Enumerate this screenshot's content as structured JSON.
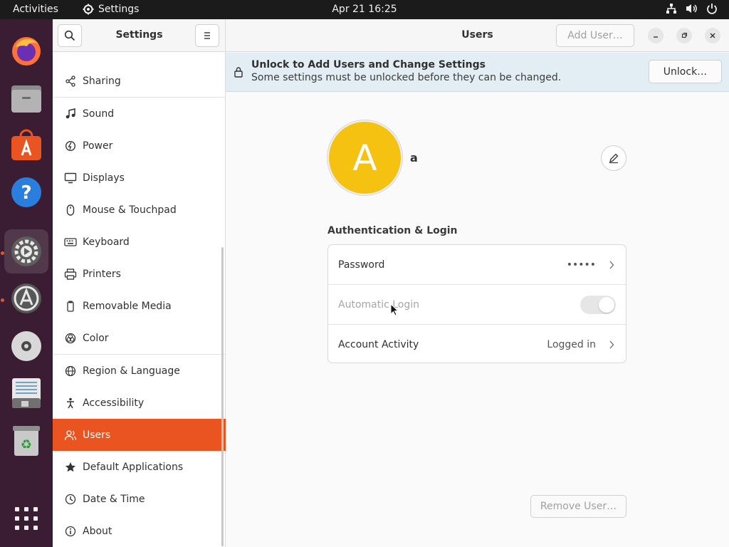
{
  "topbar": {
    "activities": "Activities",
    "app_name": "Settings",
    "clock": "Apr 21  16:25"
  },
  "dock": {
    "items": [
      "firefox-icon",
      "files-icon",
      "software-store-icon",
      "help-icon",
      "settings-icon",
      "software-updater-icon",
      "disc-icon",
      "text-editor-icon",
      "trash-icon",
      "app-grid-icon"
    ]
  },
  "sidebar": {
    "title": "Settings",
    "items": [
      {
        "label": "Sharing",
        "icon": "share-icon"
      },
      {
        "label": "Sound",
        "icon": "music-note-icon"
      },
      {
        "label": "Power",
        "icon": "power-icon"
      },
      {
        "label": "Displays",
        "icon": "display-icon"
      },
      {
        "label": "Mouse & Touchpad",
        "icon": "mouse-icon"
      },
      {
        "label": "Keyboard",
        "icon": "keyboard-icon"
      },
      {
        "label": "Printers",
        "icon": "printer-icon"
      },
      {
        "label": "Removable Media",
        "icon": "removable-media-icon"
      },
      {
        "label": "Color",
        "icon": "color-icon"
      },
      {
        "label": "Region & Language",
        "icon": "globe-icon"
      },
      {
        "label": "Accessibility",
        "icon": "accessibility-icon"
      },
      {
        "label": "Users",
        "icon": "users-icon"
      },
      {
        "label": "Default Applications",
        "icon": "star-icon"
      },
      {
        "label": "Date & Time",
        "icon": "clock-icon"
      },
      {
        "label": "About",
        "icon": "info-icon"
      }
    ],
    "selected": "Users"
  },
  "main": {
    "title": "Users",
    "add_user": "Add User…",
    "infobar": {
      "title": "Unlock to Add Users and Change Settings",
      "subtitle": "Some settings must be unlocked before they can be changed.",
      "unlock": "Unlock…"
    },
    "user": {
      "avatar_letter": "A",
      "name": "a",
      "avatar_color": "#f5c211"
    },
    "section_title": "Authentication & Login",
    "rows": {
      "password_label": "Password",
      "password_value": "•••••",
      "autologin_label": "Automatic Login",
      "activity_label": "Account Activity",
      "activity_value": "Logged in"
    },
    "remove_user": "Remove User…"
  },
  "colors": {
    "accent": "#e95420",
    "dock_bg": "#3b1d33",
    "topbar_bg": "#1b1b1b"
  }
}
